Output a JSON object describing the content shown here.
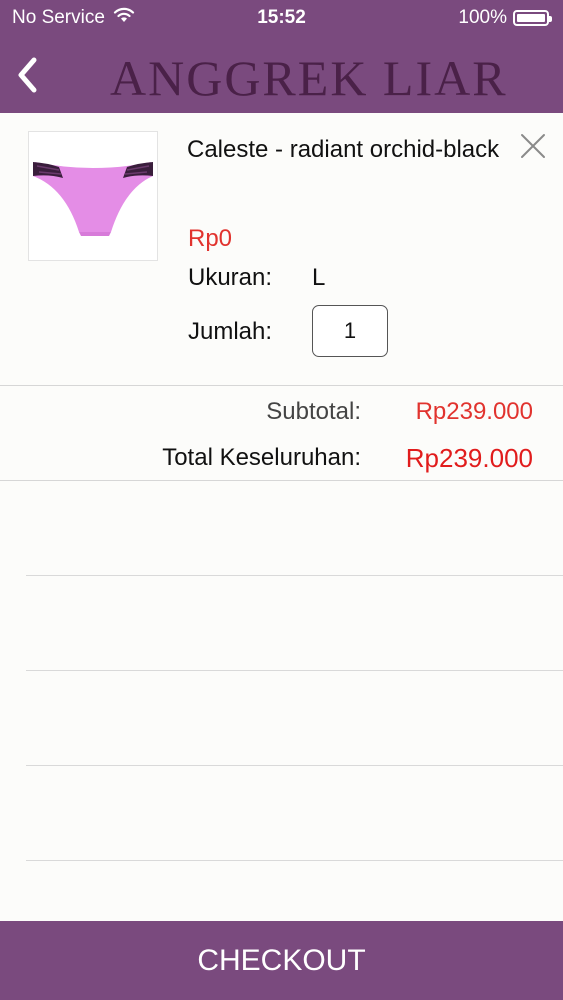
{
  "status_bar": {
    "carrier": "No Service",
    "time": "15:52",
    "battery_text": "100%",
    "battery_level": 1.0,
    "wifi_icon": "wifi-icon"
  },
  "header": {
    "brand": "ANGGREK  LIAR",
    "back_icon": "chevron-left-icon",
    "background_color": "#7a4a7e"
  },
  "cart": {
    "items": [
      {
        "name": "Caleste - radiant orchid-black",
        "price": "Rp0",
        "size_label": "Ukuran:",
        "size_value": "L",
        "qty_label": "Jumlah:",
        "qty_value": "1",
        "remove_icon": "close-icon"
      }
    ]
  },
  "summary": {
    "subtotal_label": "Subtotal:",
    "subtotal_value": "Rp239.000",
    "total_label": "Total Keseluruhan:",
    "total_value": "Rp239.000",
    "price_color": "#e1332e"
  },
  "footer": {
    "checkout_label": "CHECKOUT"
  }
}
